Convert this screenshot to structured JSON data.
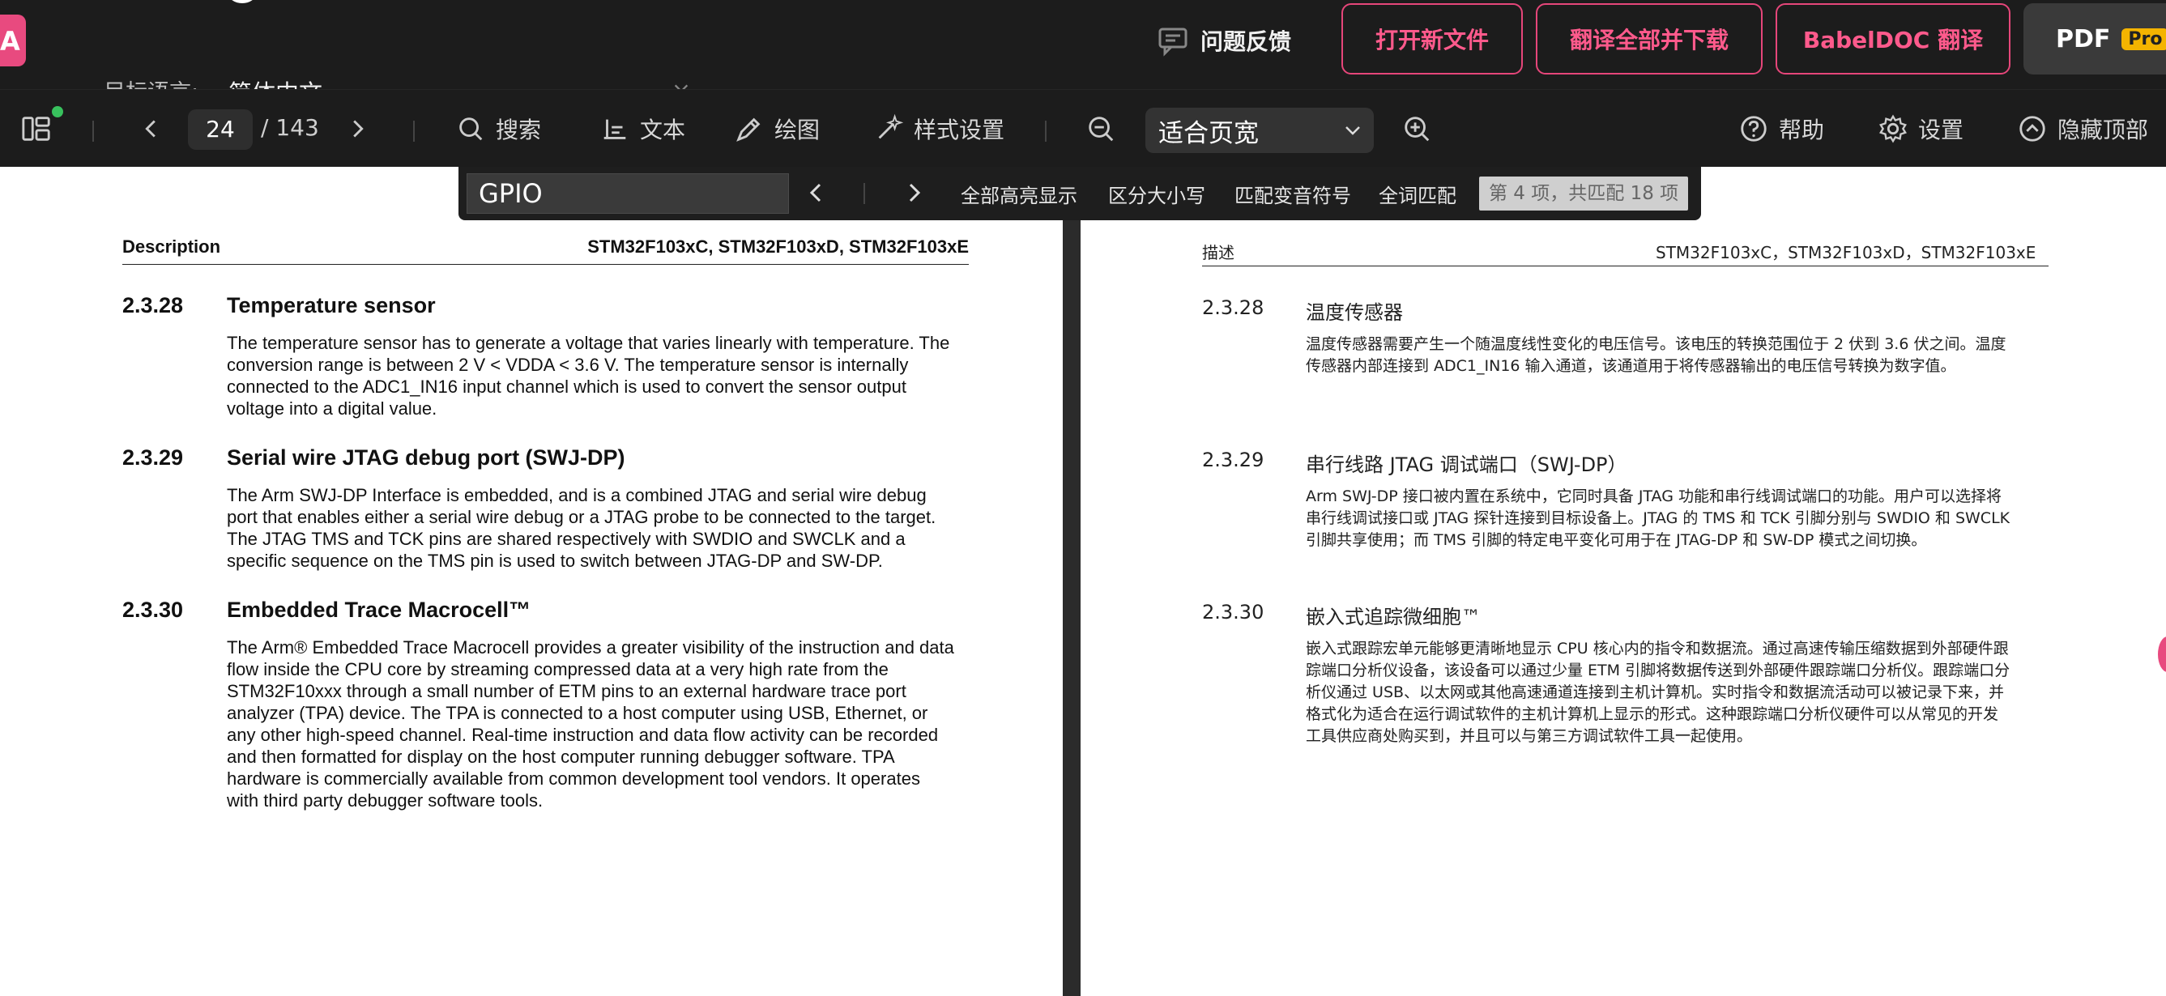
{
  "app": {
    "logo_letter": "A",
    "target_language_label": "目标语言:",
    "target_language_value": "简体中文",
    "feedback_label": "问题反馈",
    "buttons": {
      "open_file": "打开新文件",
      "translate_all": "翻译全部并下载",
      "babeldoc": "BabelDOC 翻译",
      "pdf": "PDF",
      "pro": "Pro"
    }
  },
  "toolbar": {
    "current_page": "24",
    "total_pages": "/ 143",
    "search_label": "搜索",
    "text_label": "文本",
    "draw_label": "绘图",
    "style_label": "样式设置",
    "zoom_value": "适合页宽",
    "help_label": "帮助",
    "settings_label": "设置",
    "hide_top_label": "隐藏顶部"
  },
  "search": {
    "query": "GPIO",
    "highlight_all": "全部高亮显示",
    "match_case": "区分大小写",
    "match_diacritics": "匹配变音符号",
    "whole_words": "全词匹配",
    "result_count": "第 4 项，共匹配 18 项"
  },
  "left_page": {
    "header_desc": "Description",
    "header_parts": "STM32F103xC, STM32F103xD, STM32F103xE",
    "sections": [
      {
        "num": "2.3.28",
        "title": "Temperature sensor",
        "lines": [
          "The temperature sensor has to generate a voltage that varies linearly with temperature. The",
          "conversion range is between 2 V < VDDA < 3.6 V. The temperature sensor is internally",
          "connected to the ADC1_IN16 input channel which is used to convert the sensor output",
          "voltage into a digital value."
        ]
      },
      {
        "num": "2.3.29",
        "title": "Serial wire JTAG debug port (SWJ-DP)",
        "lines": [
          "The Arm SWJ-DP Interface is embedded, and is a combined JTAG and serial wire debug",
          "port that enables either a serial wire debug or a JTAG probe to be connected to the target.",
          "The JTAG TMS and TCK pins are shared respectively with SWDIO and SWCLK and a",
          "specific sequence on the TMS pin is used to switch between JTAG-DP and SW-DP."
        ]
      },
      {
        "num": "2.3.30",
        "title": "Embedded Trace Macrocell™",
        "lines": [
          "The Arm® Embedded Trace Macrocell provides a greater visibility of the instruction and data",
          "flow inside the CPU core by streaming compressed data at a very high rate from the",
          "STM32F10xxx through a small number of ETM pins to an external hardware trace port",
          "analyzer (TPA) device. The TPA is connected to a host computer using USB, Ethernet, or",
          "any other high-speed channel. Real-time instruction and data flow activity can be recorded",
          "and then formatted for display on the host computer running debugger software. TPA",
          "hardware is commercially available from common development tool vendors. It operates",
          "with third party debugger software tools."
        ]
      }
    ]
  },
  "right_page": {
    "header_desc": "描述",
    "header_parts": "STM32F103xC，STM32F103xD，STM32F103xE",
    "sections": [
      {
        "num": "2.3.28",
        "title": "温度传感器",
        "lines": [
          "温度传感器需要产生一个随温度线性变化的电压信号。该电压的转换范围位于 2 伏到 3.6 伏之间。温度",
          "传感器内部连接到 ADC1_IN16 输入通道，该通道用于将传感器输出的电压信号转换为数字值。"
        ]
      },
      {
        "num": "2.3.29",
        "title": "串行线路 JTAG 调试端口（SWJ-DP）",
        "lines": [
          "Arm SWJ-DP 接口被内置在系统中，它同时具备 JTAG 功能和串行线调试端口的功能。用户可以选择将",
          "串行线调试接口或 JTAG 探针连接到目标设备上。JTAG 的 TMS 和 TCK 引脚分别与 SWDIO 和 SWCLK",
          "引脚共享使用；而 TMS 引脚的特定电平变化可用于在 JTAG-DP 和 SW-DP 模式之间切换。"
        ]
      },
      {
        "num": "2.3.30",
        "title": "嵌入式追踪微细胞™",
        "lines": [
          "嵌入式跟踪宏单元能够更清晰地显示 CPU 核心内的指令和数据流。通过高速传输压缩数据到外部硬件跟",
          "踪端口分析仪设备，该设备可以通过少量 ETM 引脚将数据传送到外部硬件跟踪端口分析仪。跟踪端口分",
          "析仪通过 USB、以太网或其他高速通道连接到主机计算机。实时指令和数据流活动可以被记录下来，并",
          "格式化为适合在运行调试软件的主机计算机上显示的形式。这种跟踪端口分析仪硬件可以从常见的开发",
          "工具供应商处购买到，并且可以与第三方调试软件工具一起使用。"
        ]
      }
    ]
  }
}
